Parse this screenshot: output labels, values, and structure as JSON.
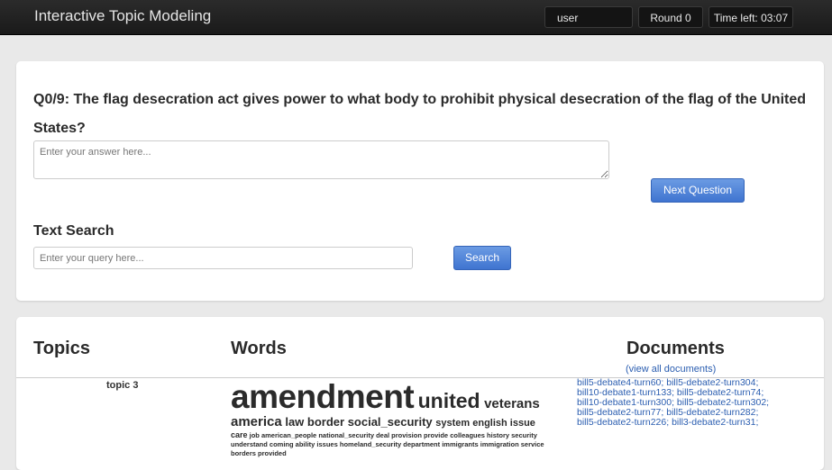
{
  "app": {
    "title": "Interactive Topic Modeling",
    "user": "user",
    "round": "Round 0",
    "time_left": "Time left: 03:07"
  },
  "question": {
    "text": "Q0/9: The flag desecration act gives power to what body to prohibit physical desecration of the flag of the United States?",
    "answer_placeholder": "Enter your answer here...",
    "next_label": "Next Question"
  },
  "search": {
    "title": "Text Search",
    "placeholder": "Enter your query here...",
    "button_label": "Search"
  },
  "topics": {
    "headers": {
      "topics": "Topics",
      "words": "Words",
      "documents": "Documents"
    },
    "view_all": "(view all documents)",
    "rows": [
      {
        "label": "topic 3",
        "words": {
          "w1": "amendment",
          "w2": "united",
          "w3": "veterans",
          "w4": "america",
          "w5": "law border social_security",
          "w6": "system english issue",
          "w7": "care",
          "w8": "job american_people national_security deal provision provide colleagues history security understand coming ability issues homeland_security department immigrants immigration service borders provided"
        },
        "documents": [
          "bill5-debate4-turn60;",
          "bill5-debate2-turn304;",
          "bill10-debate1-turn133;",
          "bill5-debate2-turn74;",
          "bill10-debate1-turn300;",
          "bill5-debate2-turn302;",
          "bill5-debate2-turn77;",
          "bill5-debate2-turn282;",
          "bill5-debate2-turn226;",
          "bill3-debate2-turn31;"
        ]
      }
    ]
  },
  "colors": {
    "topbar": "#1a1a1a",
    "button": "#4a7fd6",
    "link": "#2a5db0",
    "page_bg": "#e9e9e9"
  }
}
